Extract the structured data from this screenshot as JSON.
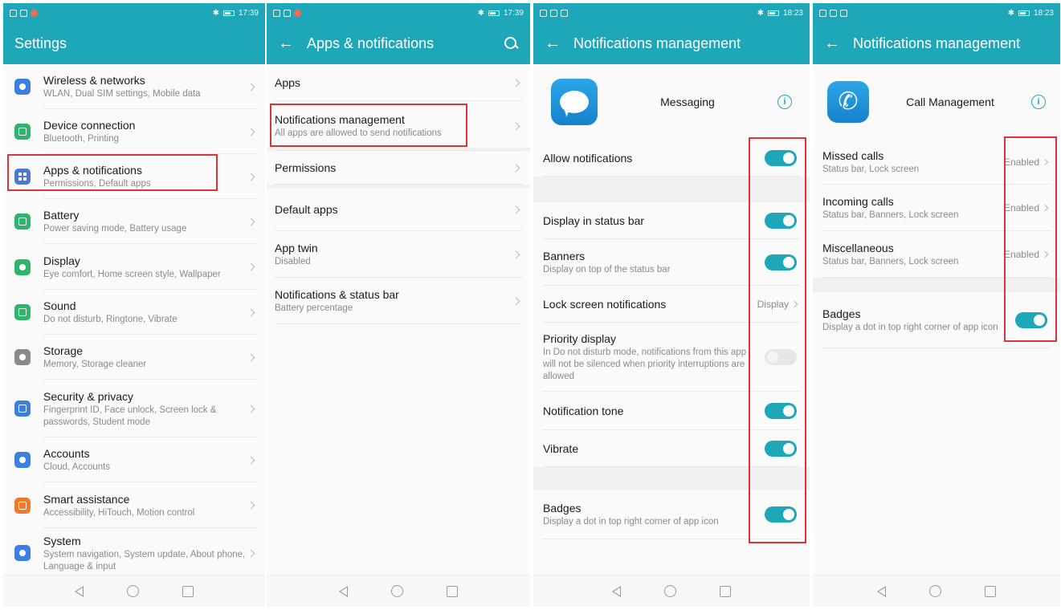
{
  "accent_color": "#1ea6b9",
  "highlight_color": "#d9363a",
  "screens": {
    "settings": {
      "status_time": "17:39",
      "title": "Settings",
      "items": [
        {
          "title": "Wireless & networks",
          "sub": "WLAN, Dual SIM settings, Mobile data",
          "icon": "wifi-icon",
          "color": "#3d7fe0"
        },
        {
          "title": "Device connection",
          "sub": "Bluetooth, Printing",
          "icon": "device-connection-icon",
          "color": "#2fb56b"
        },
        {
          "title": "Apps & notifications",
          "sub": "Permissions, Default apps",
          "icon": "apps-icon",
          "color": "#4a78d6"
        },
        {
          "title": "Battery",
          "sub": "Power saving mode, Battery usage",
          "icon": "battery-icon",
          "color": "#2fb56b"
        },
        {
          "title": "Display",
          "sub": "Eye comfort, Home screen style, Wallpaper",
          "icon": "display-icon",
          "color": "#2fb56b"
        },
        {
          "title": "Sound",
          "sub": "Do not disturb, Ringtone, Vibrate",
          "icon": "sound-icon",
          "color": "#2fb56b"
        },
        {
          "title": "Storage",
          "sub": "Memory, Storage cleaner",
          "icon": "storage-icon",
          "color": "#8a8a8a"
        },
        {
          "title": "Security & privacy",
          "sub": "Fingerprint ID, Face unlock, Screen lock & passwords, Student mode",
          "icon": "shield-icon",
          "color": "#3d7fe0"
        },
        {
          "title": "Accounts",
          "sub": "Cloud, Accounts",
          "icon": "accounts-icon",
          "color": "#3d7fe0"
        },
        {
          "title": "Smart assistance",
          "sub": "Accessibility, HiTouch, Motion control",
          "icon": "hand-icon",
          "color": "#f07a2a"
        },
        {
          "title": "System",
          "sub": "System navigation, System update, About phone, Language & input",
          "icon": "system-icon",
          "color": "#3d7fe0"
        }
      ]
    },
    "apps": {
      "status_time": "17:39",
      "title": "Apps & notifications",
      "items": [
        {
          "title": "Apps",
          "sub": ""
        },
        {
          "title": "Notifications management",
          "sub": "All apps are allowed to send notifications"
        },
        {
          "title": "Permissions",
          "sub": ""
        },
        {
          "title": "Default apps",
          "sub": ""
        },
        {
          "title": "App twin",
          "sub": "Disabled"
        },
        {
          "title": "Notifications & status bar",
          "sub": "Battery percentage"
        }
      ]
    },
    "messaging": {
      "status_time": "18:23",
      "title": "Notifications management",
      "app_name": "Messaging",
      "items": [
        {
          "title": "Allow notifications",
          "sub": "",
          "control": "toggle",
          "on": true
        },
        {
          "title": "Display in status bar",
          "sub": "",
          "control": "toggle",
          "on": true
        },
        {
          "title": "Banners",
          "sub": "Display on top of the status bar",
          "control": "toggle",
          "on": true
        },
        {
          "title": "Lock screen notifications",
          "sub": "",
          "control": "value",
          "value": "Display"
        },
        {
          "title": "Priority display",
          "sub": "In Do not disturb mode, notifications from this app will not be silenced when priority interruptions are allowed",
          "control": "toggle",
          "on": false
        },
        {
          "title": "Notification tone",
          "sub": "",
          "control": "toggle",
          "on": true
        },
        {
          "title": "Vibrate",
          "sub": "",
          "control": "toggle",
          "on": true
        },
        {
          "title": "Badges",
          "sub": "Display a dot in top right corner of app icon",
          "control": "toggle",
          "on": true
        }
      ]
    },
    "call": {
      "status_time": "18:23",
      "title": "Notifications management",
      "app_name": "Call Management",
      "items": [
        {
          "title": "Missed calls",
          "sub": "Status bar, Lock screen",
          "control": "value",
          "value": "Enabled"
        },
        {
          "title": "Incoming calls",
          "sub": "Status bar, Banners, Lock screen",
          "control": "value",
          "value": "Enabled"
        },
        {
          "title": "Miscellaneous",
          "sub": "Status bar, Banners, Lock screen",
          "control": "value",
          "value": "Enabled"
        },
        {
          "title": "Badges",
          "sub": "Display a dot in top right corner of app icon",
          "control": "toggle",
          "on": true
        }
      ]
    }
  }
}
